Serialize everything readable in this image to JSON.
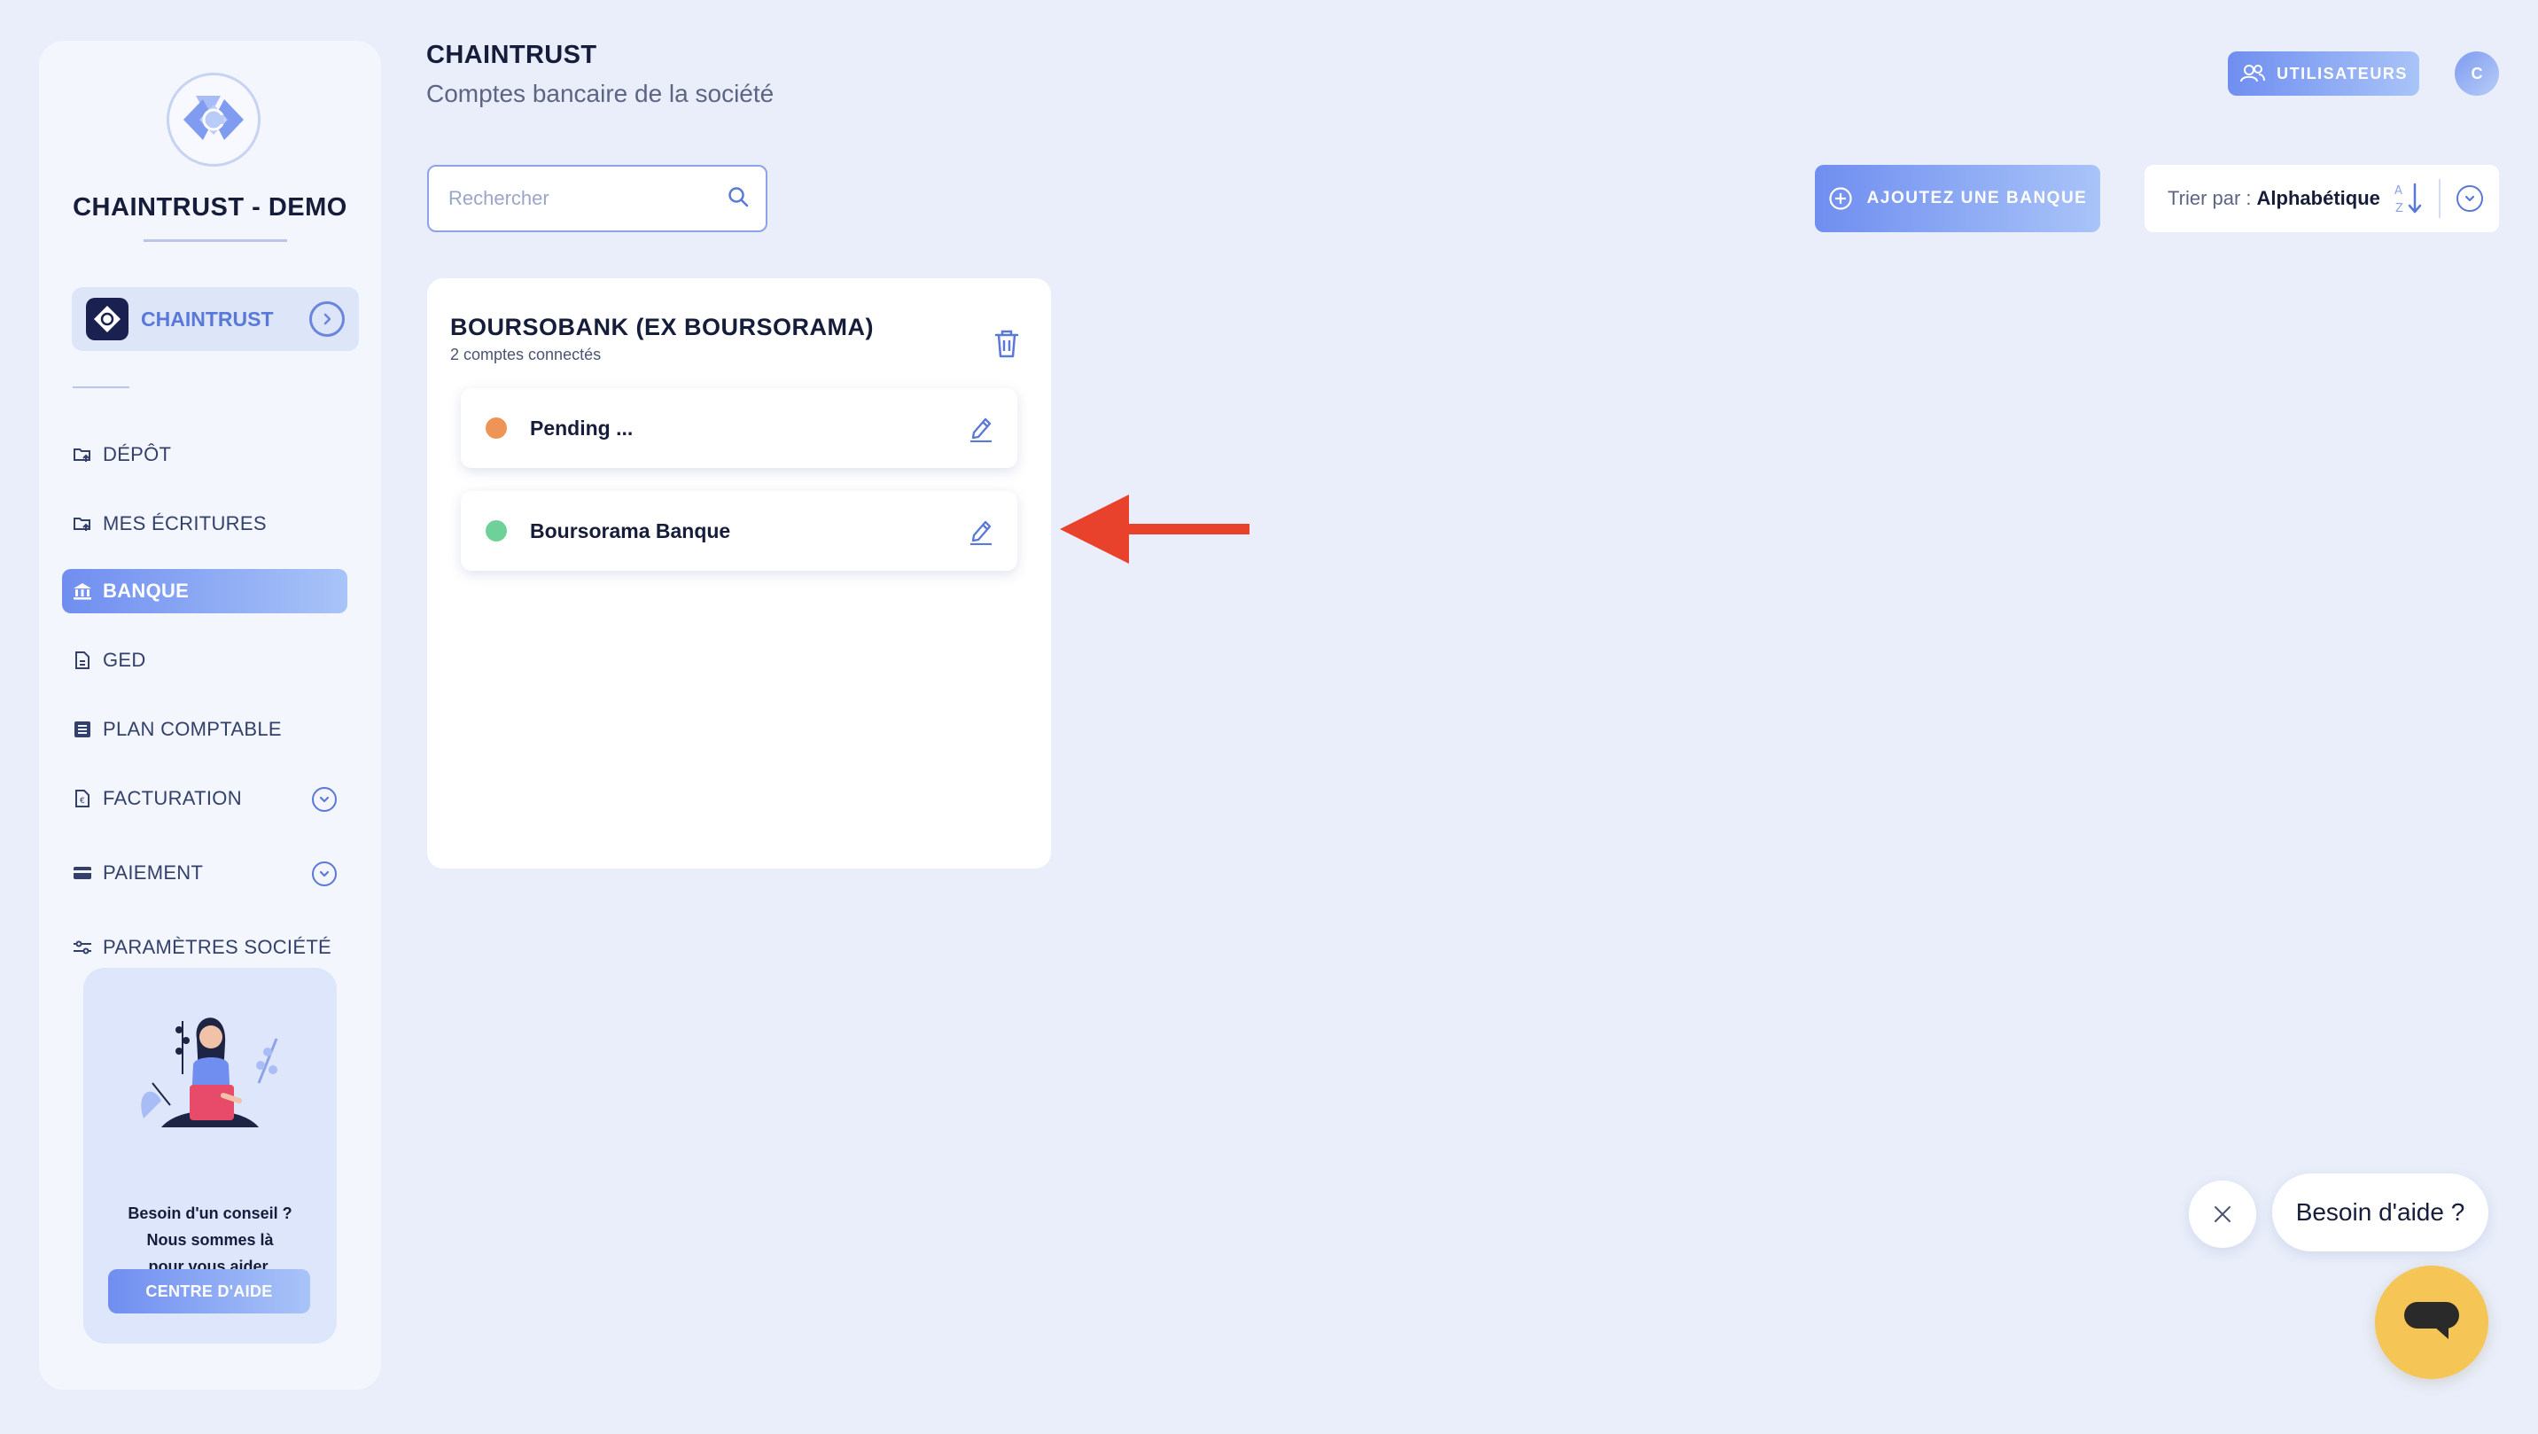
{
  "sidebar": {
    "brand_title": "CHAINTRUST - DEMO",
    "company": {
      "name": "CHAINTRUST"
    },
    "items": [
      {
        "label": "DÉPÔT",
        "icon": "folder-upload-icon"
      },
      {
        "label": "MES ÉCRITURES",
        "icon": "folder-upload-icon"
      },
      {
        "label": "BANQUE",
        "icon": "bank-icon",
        "active": true
      },
      {
        "label": "GED",
        "icon": "document-icon"
      },
      {
        "label": "PLAN COMPTABLE",
        "icon": "ledger-icon"
      },
      {
        "label": "FACTURATION",
        "icon": "invoice-icon"
      },
      {
        "label": "PAIEMENT",
        "icon": "credit-card-icon"
      },
      {
        "label": "PARAMÈTRES SOCIÉTÉ",
        "icon": "sliders-icon"
      }
    ],
    "help": {
      "line1": "Besoin d'un conseil ?",
      "line2": "Nous sommes là",
      "line3": "pour vous aider.",
      "button": "CENTRE D'AIDE"
    }
  },
  "header": {
    "title": "CHAINTRUST",
    "subtitle": "Comptes bancaire de la société",
    "users_button": "UTILISATEURS",
    "avatar_initial": "C"
  },
  "toolbar": {
    "search_placeholder": "Rechercher",
    "add_bank_button": "AJOUTEZ UNE BANQUE",
    "sort_label": "Trier par :",
    "sort_value": "Alphabétique"
  },
  "bank": {
    "name": "BOURSOBANK (EX BOURSORAMA)",
    "count": "2 comptes connectés",
    "accounts": [
      {
        "name": "Pending ...",
        "status_color": "#ee9455"
      },
      {
        "name": "Boursorama Banque",
        "status_color": "#6ed19a"
      }
    ]
  },
  "chat": {
    "bubble": "Besoin d'aide ?"
  },
  "colors": {
    "accent": "#6f8ef0",
    "annotation_arrow": "#e8412c",
    "chat_launcher": "#f5c555"
  }
}
